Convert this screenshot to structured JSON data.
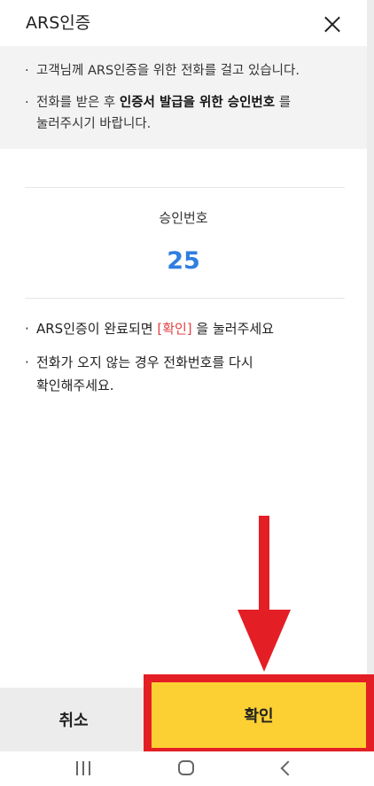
{
  "header": {
    "title": "ARS인증"
  },
  "notice": {
    "line1": "고객님께 ARS인증을 위한 전화를 걸고 있습니다.",
    "line2_pre": "전화를 받은 후 ",
    "line2_bold": "인증서 발급을 위한 승인번호",
    "line2_post": " 를",
    "line3": "눌러주시기 바랍니다."
  },
  "approval": {
    "label": "승인번호",
    "number": "25"
  },
  "info": {
    "line1_pre": "ARS인증이 완료되면 ",
    "line1_highlight": "[확인]",
    "line1_post": " 을 눌러주세요",
    "line2": "전화가 오지 않는 경우 전화번호를 다시",
    "line3": "확인해주세요."
  },
  "buttons": {
    "cancel": "취소",
    "confirm": "확인"
  },
  "colors": {
    "accent_blue": "#2f7ee0",
    "confirm_yellow": "#fcd033",
    "annotation_red": "#e41e25",
    "highlight_red": "#e14242"
  },
  "icons": {
    "close": "close-icon",
    "nav_recents": "recents-icon",
    "nav_home": "home-icon",
    "nav_back": "back-icon"
  }
}
